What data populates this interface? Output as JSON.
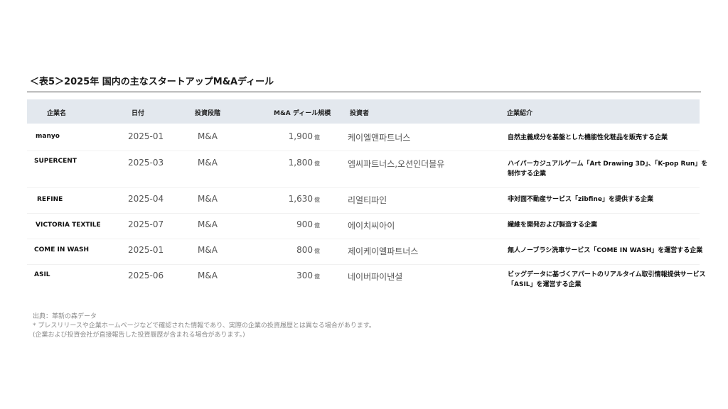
{
  "title": "＜表5＞2025年 国内の主なスタートアップM&Aディール",
  "headers": {
    "company": "企業名",
    "date": "日付",
    "stage": "投資段階",
    "scale": "M&A ディール規模",
    "investor": "投資者",
    "intro": "企業紹介"
  },
  "unit": "億",
  "rows": [
    {
      "company": "manyo",
      "date": "2025-01",
      "stage": "M&A",
      "scale": "1,900",
      "investor": "케이엘앤파트너스",
      "intro": [
        "自然主義成分を基盤とした機能性化粧品を販売する企業"
      ]
    },
    {
      "company": "SUPERCENT",
      "date": "2025-03",
      "stage": "M&A",
      "scale": "1,800",
      "investor": "엠씨파트너스,오션인더블유",
      "intro": [
        "ハイパーカジュアルゲーム「Art Drawing 3D」、「K-pop Run」を",
        "制作する企業"
      ]
    },
    {
      "company": "REFINE",
      "date": "2025-04",
      "stage": "M&A",
      "scale": "1,630",
      "investor": "리얼티파인",
      "intro": [
        "非対面不動産サービス「zibfine」を提供する企業"
      ]
    },
    {
      "company": "VICTORIA TEXTILE",
      "date": "2025-07",
      "stage": "M&A",
      "scale": "900",
      "investor": "에이치씨아이",
      "intro": [
        "繊維を開発および製造する企業"
      ]
    },
    {
      "company": "COME IN WASH",
      "date": "2025-01",
      "stage": "M&A",
      "scale": "800",
      "investor": "제이케이엘파트너스",
      "intro": [
        "無人ノーブラシ洗車サービス「COME IN WASH」を運営する企業"
      ]
    },
    {
      "company": "ASIL",
      "date": "2025-06",
      "stage": "M&A",
      "scale": "300",
      "investor": "네이버파이낸셜",
      "intro": [
        "ビッグデータに基づくアパートのリアルタイム取引情報提供サービス",
        "「ASIL」を運営する企業"
      ]
    }
  ],
  "footer": {
    "source": "出典：革新の森データ",
    "note1": "* プレスリリースや企業ホームページなどで確認された情報であり、実際の企業の投資履歴とは異なる場合があります。",
    "note2": "(企業および投資会社が直接報告した投資履歴が含まれる場合があります。)"
  }
}
